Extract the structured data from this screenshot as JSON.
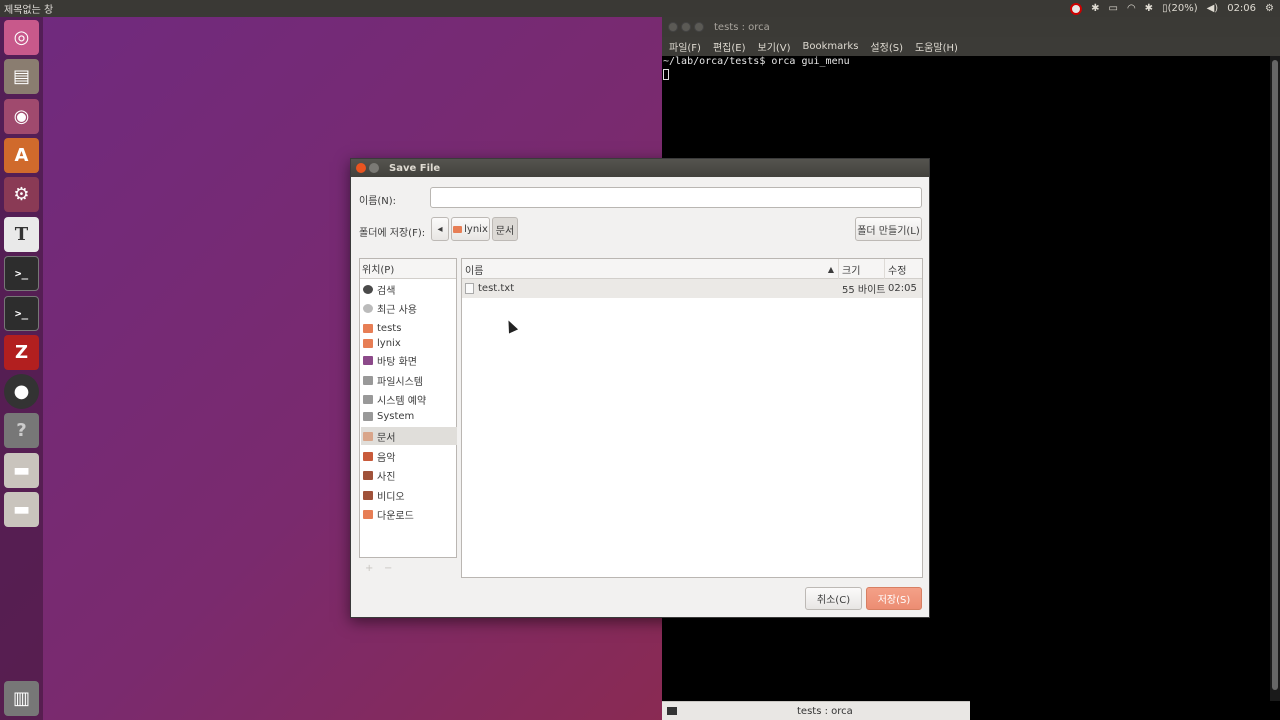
{
  "top_panel": {
    "title": "제목없는 창",
    "battery": "(20%)",
    "time": "02:06"
  },
  "terminal": {
    "title": "tests : orca",
    "menu": [
      "파일(F)",
      "편집(E)",
      "보기(V)",
      "Bookmarks",
      "설정(S)",
      "도움말(H)"
    ],
    "prompt_line": "~/lab/orca/tests$ orca gui_menu"
  },
  "taskbar": {
    "label": "tests : orca"
  },
  "dialog": {
    "title": "Save File",
    "name_label": "이름(N):",
    "name_value": "",
    "save_in_label": "폴더에 저장(F):",
    "path_buttons": [
      "lynix",
      "문서"
    ],
    "create_folder": "폴더 만들기(L)",
    "places_header": "위치(P)",
    "places": [
      "검색",
      "최근 사용",
      "tests",
      "lynix",
      "바탕 화면",
      "파일시스템",
      "시스템 예약",
      "System",
      "문서",
      "음악",
      "사진",
      "비디오",
      "다운로드"
    ],
    "selected_place": "문서",
    "columns": {
      "name": "이름",
      "size": "크기",
      "modified": "수정"
    },
    "files": [
      {
        "name": "test.txt",
        "size": "55 바이트",
        "modified": "02:05"
      }
    ],
    "cancel": "취소(C)",
    "save": "저장(S)"
  }
}
